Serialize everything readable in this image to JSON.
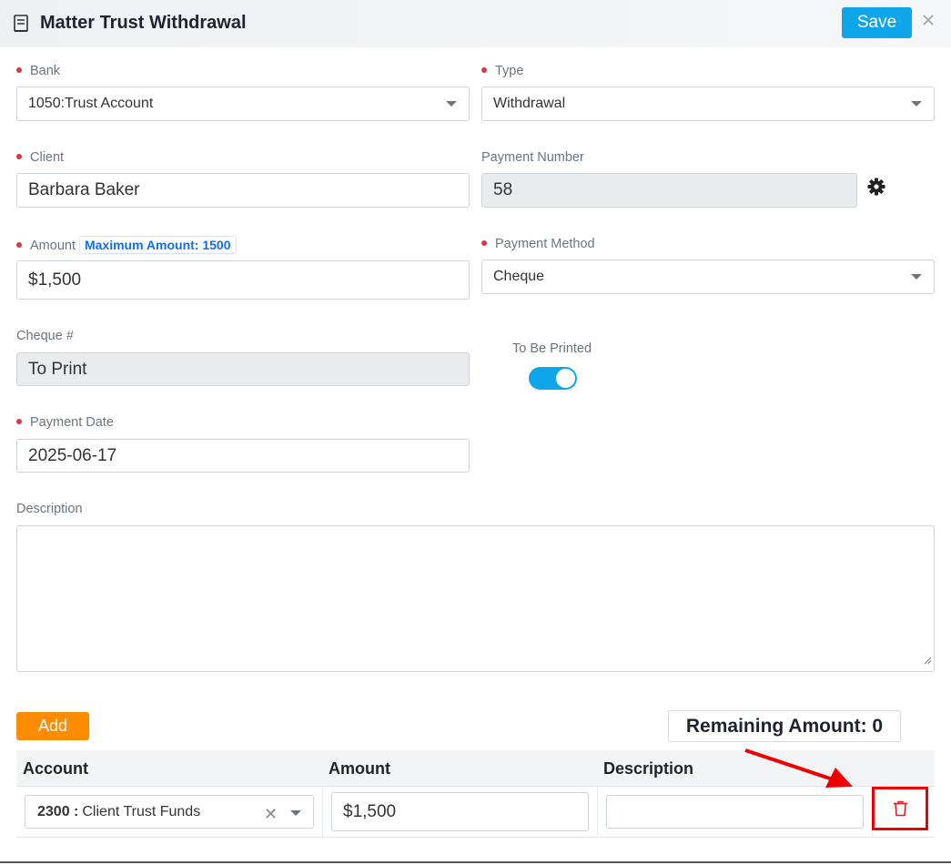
{
  "header": {
    "title": "Matter Trust Withdrawal",
    "save_label": "Save"
  },
  "form": {
    "bank": {
      "label": "Bank",
      "value": "1050:Trust Account"
    },
    "type": {
      "label": "Type",
      "value": "Withdrawal"
    },
    "client": {
      "label": "Client",
      "value": "Barbara Baker"
    },
    "payment_number": {
      "label": "Payment Number",
      "value": "58"
    },
    "amount": {
      "label": "Amount",
      "max_badge": "Maximum Amount: 1500",
      "value": "$1,500"
    },
    "payment_method": {
      "label": "Payment Method",
      "value": "Cheque"
    },
    "cheque": {
      "label": "Cheque #",
      "value": "To Print"
    },
    "to_be_printed": {
      "label": "To Be Printed",
      "checked": true
    },
    "payment_date": {
      "label": "Payment Date",
      "value": "2025-06-17"
    },
    "description": {
      "label": "Description",
      "value": ""
    }
  },
  "lines": {
    "add_label": "Add",
    "remaining": "Remaining Amount: 0",
    "columns": [
      "Account",
      "Amount",
      "Description"
    ],
    "rows": [
      {
        "account_code": "2300 :",
        "account_name": "Client Trust Funds",
        "amount": "$1,500",
        "description": ""
      }
    ]
  },
  "colors": {
    "accent": "#0ea5e9",
    "add": "#fd8c00",
    "required": "#dc3545",
    "delete": "#ee0000"
  }
}
